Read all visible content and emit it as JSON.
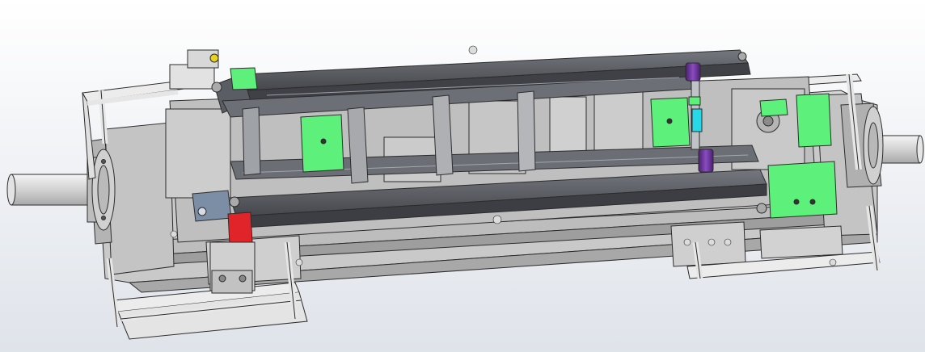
{
  "viewport": {
    "background_top": "#ffffff",
    "background_bottom": "#dfe3ea"
  },
  "palette": {
    "frame": "#c9c9c9",
    "frame_dark": "#9a9a9a",
    "edge": "#2c2c2c",
    "beam": "#55585f",
    "beam_light": "#8c8f96",
    "plate": "#d6d6d6",
    "pipe": "#e6e6e6",
    "sensor_green": "#5df07a",
    "cylinder_purple": "#6a2f9a",
    "clamp_red": "#e0242a",
    "block_blue": "#7c8ea6",
    "accent_yellow": "#e8d21c",
    "accent_cyan": "#27d8e6"
  },
  "parts": {
    "base_frame": "base-frame",
    "shaft_left": "shaft-left",
    "shaft_right": "shaft-right",
    "guard_rails": "guard-rails",
    "upper_beam": "upper-beam",
    "lower_beam": "lower-beam",
    "sensors": "sensor-plates",
    "cylinder": "pneumatic-cylinder",
    "clamp": "red-clamp"
  }
}
